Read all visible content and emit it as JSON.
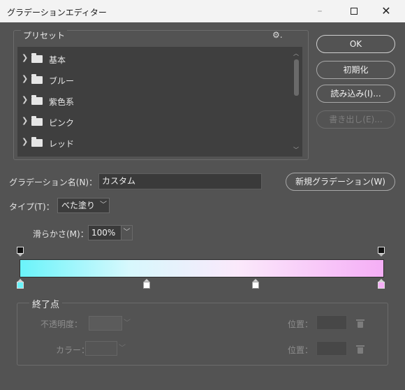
{
  "window": {
    "title": "グラデーションエディター",
    "minimize": "–",
    "close": "✕"
  },
  "presets": {
    "legend": "プリセット",
    "gear": "⚙.",
    "items": [
      {
        "label": "基本"
      },
      {
        "label": "ブルー"
      },
      {
        "label": "紫色系"
      },
      {
        "label": "ピンク"
      },
      {
        "label": "レッド"
      }
    ]
  },
  "buttons": {
    "ok": "OK",
    "reset": "初期化",
    "load": "読み込み(I)...",
    "export": "書き出し(E)..."
  },
  "name": {
    "label": "グラデーション名(N)：",
    "value": "カスタム",
    "new_button": "新規グラデーション(W)"
  },
  "type": {
    "label": "タイプ(T)：",
    "value": "べた塗り"
  },
  "smoothness": {
    "label": "滑らかさ(M)：",
    "value": "100%"
  },
  "gradient": {
    "colors": [
      "#6af4fa",
      "#d7f8fd",
      "#fbe9fb",
      "#f5aef6"
    ],
    "opacity_stops": [
      {
        "location": 0,
        "color": "#000000"
      },
      {
        "location": 100,
        "color": "#000000"
      }
    ],
    "color_stops": [
      {
        "location": 0,
        "color": "#6af4fa"
      },
      {
        "location": 34,
        "color": "#ffffff"
      },
      {
        "location": 64,
        "color": "#ffffff"
      },
      {
        "location": 100,
        "color": "#f5aef6"
      }
    ]
  },
  "end_point": {
    "legend": "終了点",
    "opacity_label": "不透明度：",
    "color_label": "カラー：",
    "location_label_1": "位置：",
    "location_label_2": "位置："
  }
}
